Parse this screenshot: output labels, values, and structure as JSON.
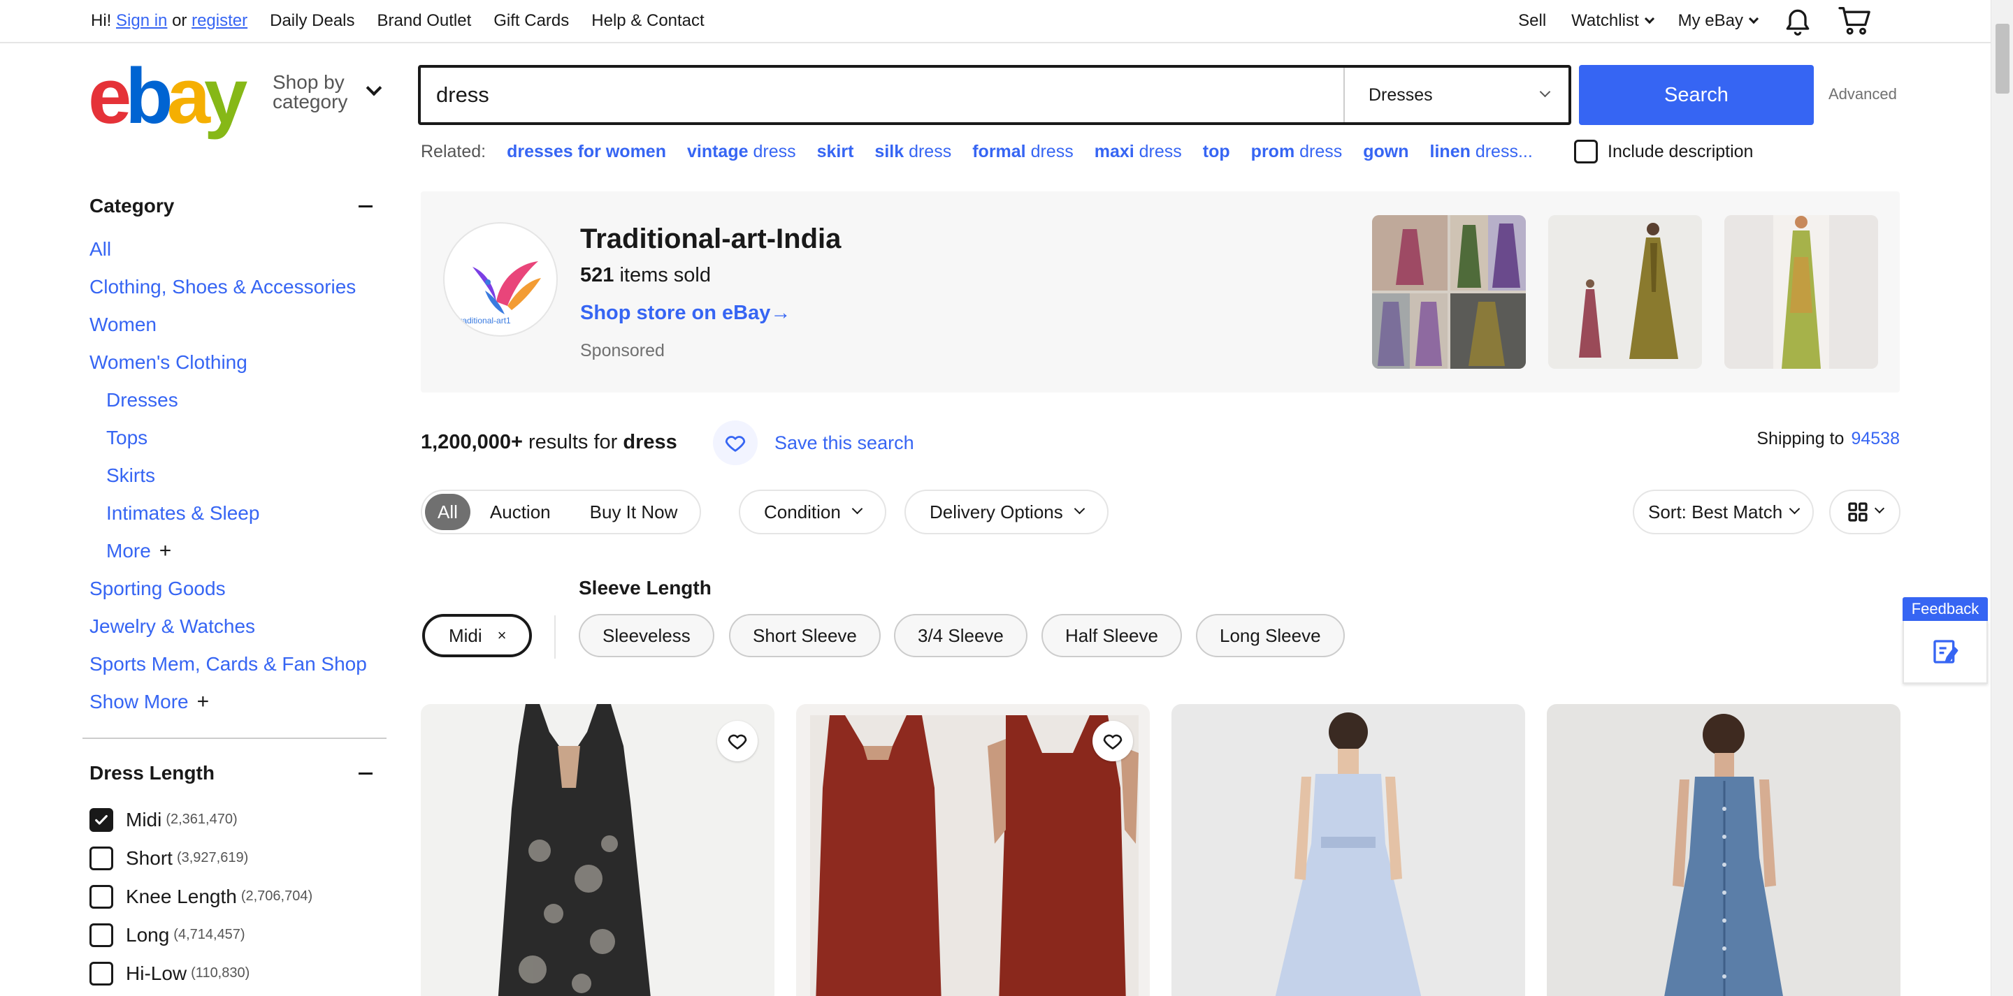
{
  "topbar": {
    "greeting_prefix": "Hi!",
    "sign_in": "Sign in",
    "or": "or",
    "register": "register",
    "links": [
      "Daily Deals",
      "Brand Outlet",
      "Gift Cards",
      "Help & Contact"
    ],
    "sell": "Sell",
    "watchlist": "Watchlist",
    "my_ebay": "My eBay"
  },
  "logo": {
    "letters": [
      "e",
      "b",
      "a",
      "y"
    ]
  },
  "shop_by_category": {
    "line1": "Shop by",
    "line2": "category"
  },
  "search": {
    "value": "dress",
    "category_selected": "Dresses",
    "button": "Search",
    "advanced": "Advanced"
  },
  "related": {
    "label": "Related:",
    "items": [
      {
        "bold": "dresses for women",
        "rest": ""
      },
      {
        "bold": "vintage",
        "rest": " dress"
      },
      {
        "bold": "skirt",
        "rest": ""
      },
      {
        "bold": "silk",
        "rest": " dress"
      },
      {
        "bold": "formal",
        "rest": " dress"
      },
      {
        "bold": "maxi",
        "rest": " dress"
      },
      {
        "bold": "top",
        "rest": ""
      },
      {
        "bold": "prom",
        "rest": " dress"
      },
      {
        "bold": "gown",
        "rest": ""
      },
      {
        "bold": "linen",
        "rest": " dress..."
      }
    ],
    "include_description": "Include description"
  },
  "sidebar": {
    "category_title": "Category",
    "items": [
      {
        "label": "All",
        "indent": false
      },
      {
        "label": "Clothing, Shoes & Accessories",
        "indent": false
      },
      {
        "label": "Women",
        "indent": false
      },
      {
        "label": "Women's Clothing",
        "indent": false
      },
      {
        "label": "Dresses",
        "indent": true
      },
      {
        "label": "Tops",
        "indent": true
      },
      {
        "label": "Skirts",
        "indent": true
      },
      {
        "label": "Intimates & Sleep",
        "indent": true
      },
      {
        "label": "More",
        "indent": true
      },
      {
        "label": "Sporting Goods",
        "indent": false
      },
      {
        "label": "Jewelry & Watches",
        "indent": false
      },
      {
        "label": "Sports Mem, Cards & Fan Shop",
        "indent": false
      },
      {
        "label": "Show More",
        "indent": false
      }
    ],
    "plus": "+",
    "dress_length_title": "Dress Length",
    "dress_lengths": [
      {
        "label": "Midi",
        "count": "(2,361,470)",
        "checked": true
      },
      {
        "label": "Short",
        "count": "(3,927,619)",
        "checked": false
      },
      {
        "label": "Knee Length",
        "count": "(2,706,704)",
        "checked": false
      },
      {
        "label": "Long",
        "count": "(4,714,457)",
        "checked": false
      },
      {
        "label": "Hi-Low",
        "count": "(110,830)",
        "checked": false
      }
    ]
  },
  "store": {
    "name": "Traditional-art-India",
    "sold_count": "521",
    "sold_label": " items sold",
    "link": "Shop store on eBay",
    "sponsored": "Sponsored",
    "logo_text": "traditional-art1"
  },
  "results": {
    "count": "1,200,000+",
    "mid": " results for ",
    "query": "dress",
    "save_search": "Save this search",
    "shipping_label": "Shipping to",
    "zip": "94538"
  },
  "filters": {
    "buying_format": [
      "All",
      "Auction",
      "Buy It Now"
    ],
    "condition": "Condition",
    "delivery": "Delivery Options",
    "sort": "Sort: Best Match"
  },
  "sleeve": {
    "title": "Sleeve Length",
    "active_chip": "Midi",
    "remove": "×",
    "options": [
      "Sleeveless",
      "Short Sleeve",
      "3/4 Sleeve",
      "Half Sleeve",
      "Long Sleeve"
    ]
  },
  "feedback": {
    "label": "Feedback"
  },
  "colors": {
    "accent": "#3665f3",
    "text": "#191919",
    "muted": "#707070",
    "logo_e": "#e53238",
    "logo_b": "#0064d2",
    "logo_a": "#f5af02",
    "logo_y": "#86b817"
  }
}
